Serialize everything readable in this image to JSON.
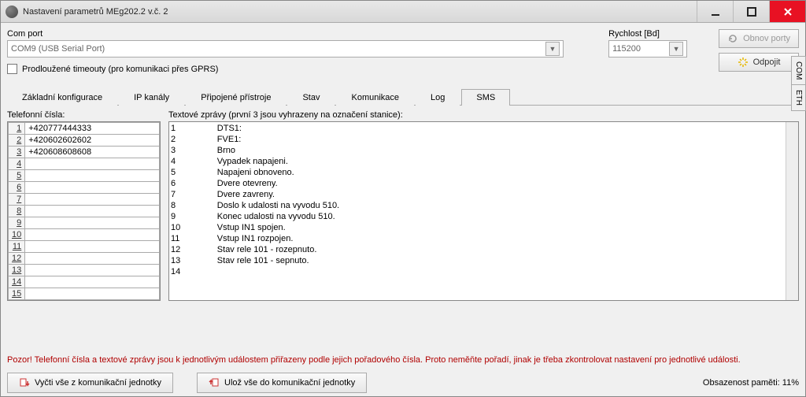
{
  "window": {
    "title": "Nastavení parametrů MEg202.2 v.č. 2"
  },
  "comport": {
    "label": "Com port",
    "value": "COM9 (USB Serial Port)"
  },
  "speed": {
    "label": "Rychlost [Bd]",
    "value": "115200"
  },
  "buttons": {
    "refresh_ports": "Obnov porty",
    "disconnect": "Odpojit",
    "read_all": "Vyčti vše z komunikační jednotky",
    "save_all": "Ulož vše do komunikační jednotky"
  },
  "checkbox": {
    "extended_timeouts": "Prodloužené timeouty (pro komunikaci přes GPRS)"
  },
  "side_tabs": {
    "com": "COM",
    "eth": "ETH"
  },
  "tabs": [
    "Základní konfigurace",
    "IP kanály",
    "Připojené přístroje",
    "Stav",
    "Komunikace",
    "Log",
    "SMS"
  ],
  "phones": {
    "label": "Telefonní čísla:",
    "rows": [
      "+420777444333",
      "+420602602602",
      "+420608608608",
      "",
      "",
      "",
      "",
      "",
      "",
      "",
      "",
      "",
      "",
      "",
      ""
    ]
  },
  "messages": {
    "label": "Textové zprávy (první 3 jsou vyhrazeny na označení stanice):",
    "rows": [
      "DTS1:",
      "FVE1:",
      "Brno",
      "Vypadek napajeni.",
      "Napajeni obnoveno.",
      "Dvere otevreny.",
      "Dvere zavreny.",
      "Doslo k udalosti na vyvodu 510.",
      "Konec udalosti na vyvodu 510.",
      "Vstup IN1 spojen.",
      "Vstup IN1 rozpojen.",
      "Stav rele 101 - rozepnuto.",
      "Stav rele 101 - sepnuto.",
      ""
    ]
  },
  "warning": "Pozor! Telefonní čísla a textové zprávy jsou k jednotlivým událostem přiřazeny podle jejich pořadového čísla. Proto neměňte pořadí, jinak je třeba zkontrolovat nastavení pro jednotlivé události.",
  "memory": "Obsazenost paměti: 11%"
}
